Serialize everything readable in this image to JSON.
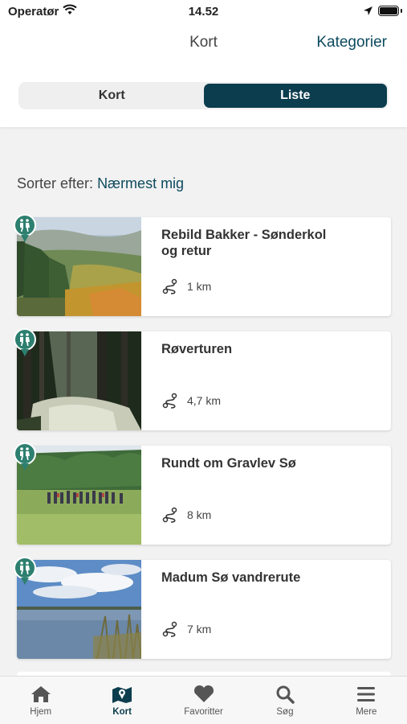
{
  "status_bar": {
    "carrier": "Operatør",
    "time": "14.52"
  },
  "nav": {
    "title": "Kort",
    "action": "Kategorier"
  },
  "segments": {
    "map_label": "Kort",
    "list_label": "Liste",
    "selected": "Liste"
  },
  "sort": {
    "label": "Sorter efter:",
    "value": "Nærmest mig"
  },
  "colors": {
    "accent": "#0c3d4e",
    "pin": "#2d7f6f"
  },
  "routes": [
    {
      "title": "Rebild Bakker - Sønderkol og retur",
      "distance": "1 km",
      "category_icon": "hiker-icon"
    },
    {
      "title": "Røverturen",
      "distance": "4,7 km",
      "category_icon": "hiker-icon"
    },
    {
      "title": "Rundt om Gravlev Sø",
      "distance": "8 km",
      "category_icon": "hiker-icon"
    },
    {
      "title": "Madum Sø vandrerute",
      "distance": "7 km",
      "category_icon": "hiker-icon"
    }
  ],
  "tabs": [
    {
      "label": "Hjem",
      "icon": "home-icon"
    },
    {
      "label": "Kort",
      "icon": "map-icon"
    },
    {
      "label": "Favoritter",
      "icon": "heart-icon"
    },
    {
      "label": "Søg",
      "icon": "search-icon"
    },
    {
      "label": "Mere",
      "icon": "menu-icon"
    }
  ]
}
